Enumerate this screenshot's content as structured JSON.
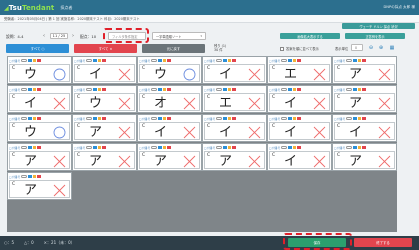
{
  "header": {
    "logo_main": "Tsu",
    "logo_accent": "Tendant",
    "subtitle": "採点者",
    "user": "DNPの採点 太郎 様",
    "colors": {
      "bar": "#2c6f8e",
      "logo_accent": "#8ee04f"
    }
  },
  "infobar": {
    "text": "受験者：2021年05月04日 | 第 1 回 実施名称：2020期末テスト 科目：2020期末テスト",
    "right_button": "ヴェーチ ドルン 採点 状況"
  },
  "controls": {
    "question_label": "設問：4-4",
    "page_current": "11 / 25",
    "page_prev": "‹",
    "page_next": "›",
    "score_label": "配点：10",
    "filter_placeholder": "フィルタ条件指定",
    "sort_select": "一字単語順ソート",
    "show_all_button": "画像拡大表示する",
    "refresh_button": "正答例を表示",
    "checkbox_label": "答案を順に並べて表示",
    "display_label": "表示単位",
    "display_value": "8"
  },
  "action_buttons": {
    "ok": "すべて ○",
    "ng": "すべて ×",
    "undo": "元に戻す",
    "count_label": "残り (1)",
    "count_sub": "30 件"
  },
  "cards": [
    {
      "glyph": "ウ",
      "mark": "circle"
    },
    {
      "glyph": "イ",
      "mark": "cross"
    },
    {
      "glyph": "ウ",
      "mark": "circle"
    },
    {
      "glyph": "イ",
      "mark": "cross"
    },
    {
      "glyph": "エ",
      "mark": "cross"
    },
    {
      "glyph": "ア",
      "mark": "cross"
    },
    {
      "glyph": "イ",
      "mark": "cross"
    },
    {
      "glyph": "ウ",
      "mark": "cross"
    },
    {
      "glyph": "オ",
      "mark": "cross"
    },
    {
      "glyph": "エ",
      "mark": "cross"
    },
    {
      "glyph": "イ",
      "mark": "cross"
    },
    {
      "glyph": "ア",
      "mark": "cross"
    },
    {
      "glyph": "ウ",
      "mark": "circle"
    },
    {
      "glyph": "ア",
      "mark": "cross"
    },
    {
      "glyph": "イ",
      "mark": "cross"
    },
    {
      "glyph": "イ",
      "mark": "cross"
    },
    {
      "glyph": "イ",
      "mark": "cross"
    },
    {
      "glyph": "イ",
      "mark": "cross"
    },
    {
      "glyph": "ア",
      "mark": "cross"
    },
    {
      "glyph": "ア",
      "mark": "cross"
    },
    {
      "glyph": "ア",
      "mark": "cross"
    },
    {
      "glyph": "ア",
      "mark": "cross"
    },
    {
      "glyph": "イ",
      "mark": "cross"
    },
    {
      "glyph": "ア",
      "mark": "cross"
    },
    {
      "glyph": "ア",
      "mark": "cross"
    }
  ],
  "card_header_text": "□ 付番号",
  "card_c": "C",
  "footer": {
    "stat_ok": "○：5",
    "stat_partial": "△：0",
    "stat_ng": "×：21（未：0）",
    "save_button": "保存",
    "close_button": "終了する"
  },
  "icons": [
    "chevron-left-icon",
    "chevron-right-icon",
    "zoom-in-icon",
    "zoom-out-icon",
    "grid-icon",
    "circle-mark-icon",
    "cross-mark-icon"
  ]
}
